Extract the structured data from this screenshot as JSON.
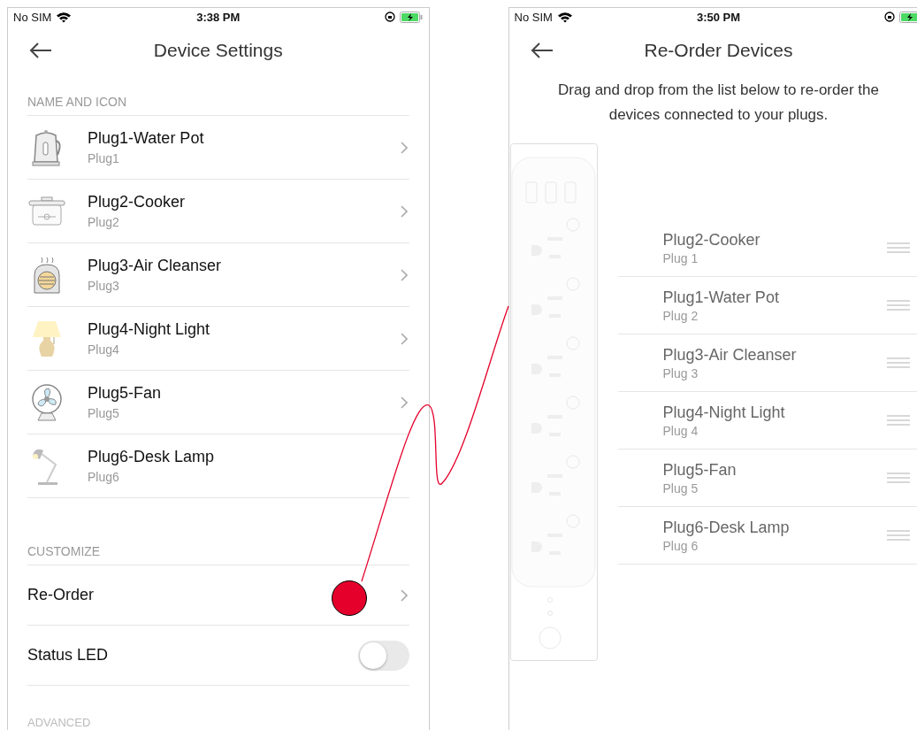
{
  "device_settings": {
    "status_bar": {
      "carrier": "No SIM",
      "time": "3:38 PM"
    },
    "title": "Device Settings",
    "sections": [
      {
        "heading": "NAME AND ICON",
        "devices": [
          {
            "name": "Plug1-Water Pot",
            "plug": "Plug1"
          },
          {
            "name": "Plug2-Cooker",
            "plug": "Plug2"
          },
          {
            "name": "Plug3-Air Cleanser",
            "plug": "Plug3"
          },
          {
            "name": "Plug4-Night Light",
            "plug": "Plug4"
          },
          {
            "name": "Plug5-Fan",
            "plug": "Plug5"
          },
          {
            "name": "Plug6-Desk Lamp",
            "plug": "Plug6"
          }
        ]
      }
    ],
    "customize": {
      "heading": "CUSTOMIZE",
      "items": [
        {
          "kind": "link",
          "label": "Re-Order"
        },
        {
          "kind": "toggle",
          "label": "Status LED",
          "on": false
        }
      ]
    },
    "advanced_heading": "ADVANCED"
  },
  "reorder_devices": {
    "status_bar": {
      "carrier": "No SIM",
      "time": "3:50 PM"
    },
    "title": "Re-Order Devices",
    "description": "Drag and drop from the list below to re-order the devices connected to your plugs.",
    "devices": [
      {
        "name": "Plug2-Cooker",
        "plug": "Plug 1"
      },
      {
        "name": "Plug1-Water Pot",
        "plug": "Plug 2"
      },
      {
        "name": "Plug3-Air Cleanser",
        "plug": "Plug 3"
      },
      {
        "name": "Plug4-Night Light",
        "plug": "Plug 4"
      },
      {
        "name": "Plug5-Fan",
        "plug": "Plug 5"
      },
      {
        "name": "Plug6-Desk Lamp",
        "plug": "Plug 6"
      }
    ]
  }
}
